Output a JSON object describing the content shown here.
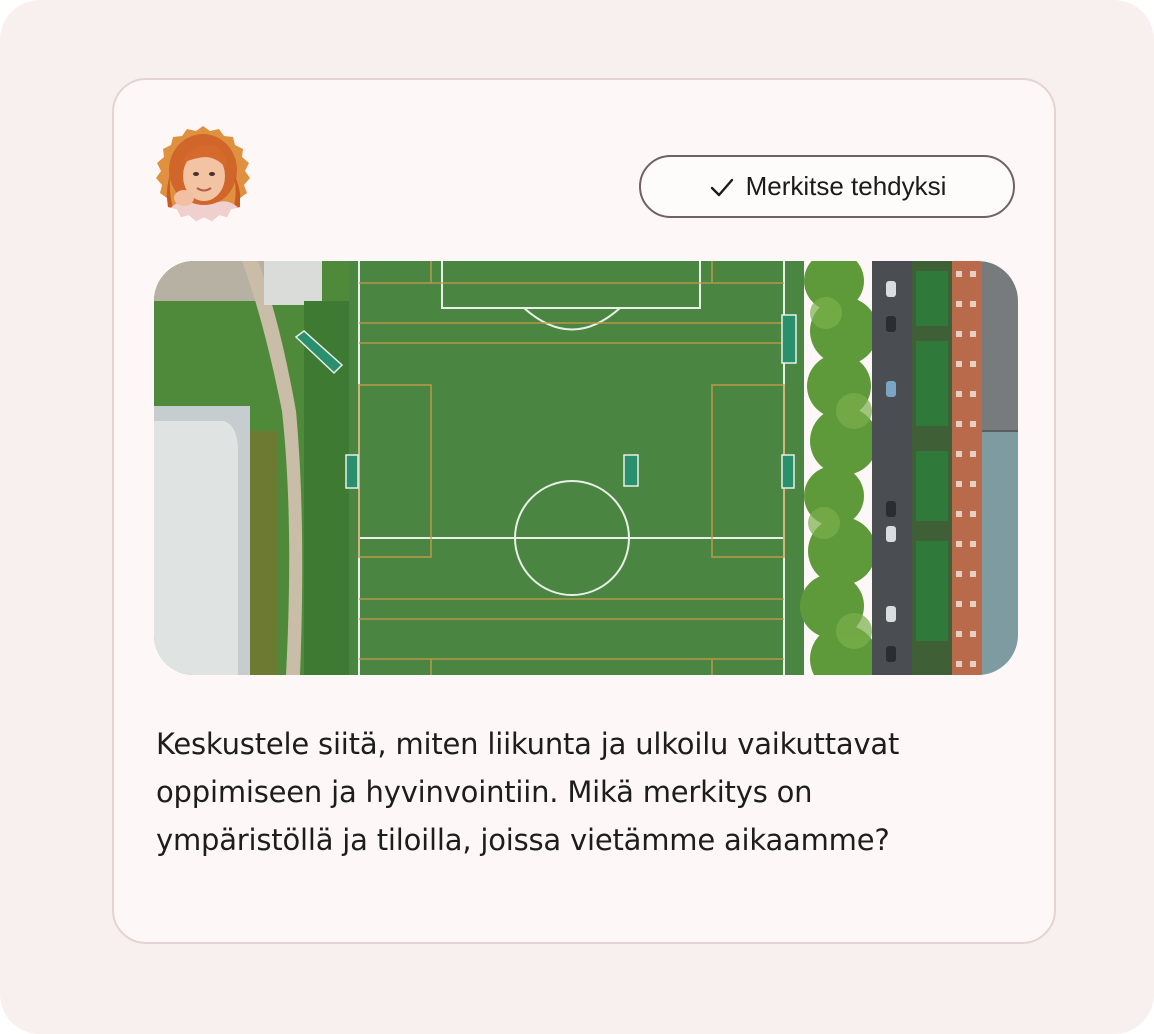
{
  "card": {
    "avatar_icon": "user-avatar",
    "mark_done": {
      "icon": "checkmark-icon",
      "label": "Merkitse tehdyksi"
    },
    "image_subject": "aerial-football-field",
    "description": "Keskustele siitä, miten liikunta ja ulkoilu vaikuttavat oppimiseen ja hyvinvointiin. Mikä merkitys on ympäristöllä ja tiloilla, joissa vietämme aikaamme?"
  },
  "colors": {
    "page_background": "#f8f0ee",
    "card_background": "#fdf8f7",
    "card_border": "#e3d4d2",
    "button_border": "#6e6262",
    "text": "#1e1c1c",
    "pitch_green": "#4f8a44"
  }
}
